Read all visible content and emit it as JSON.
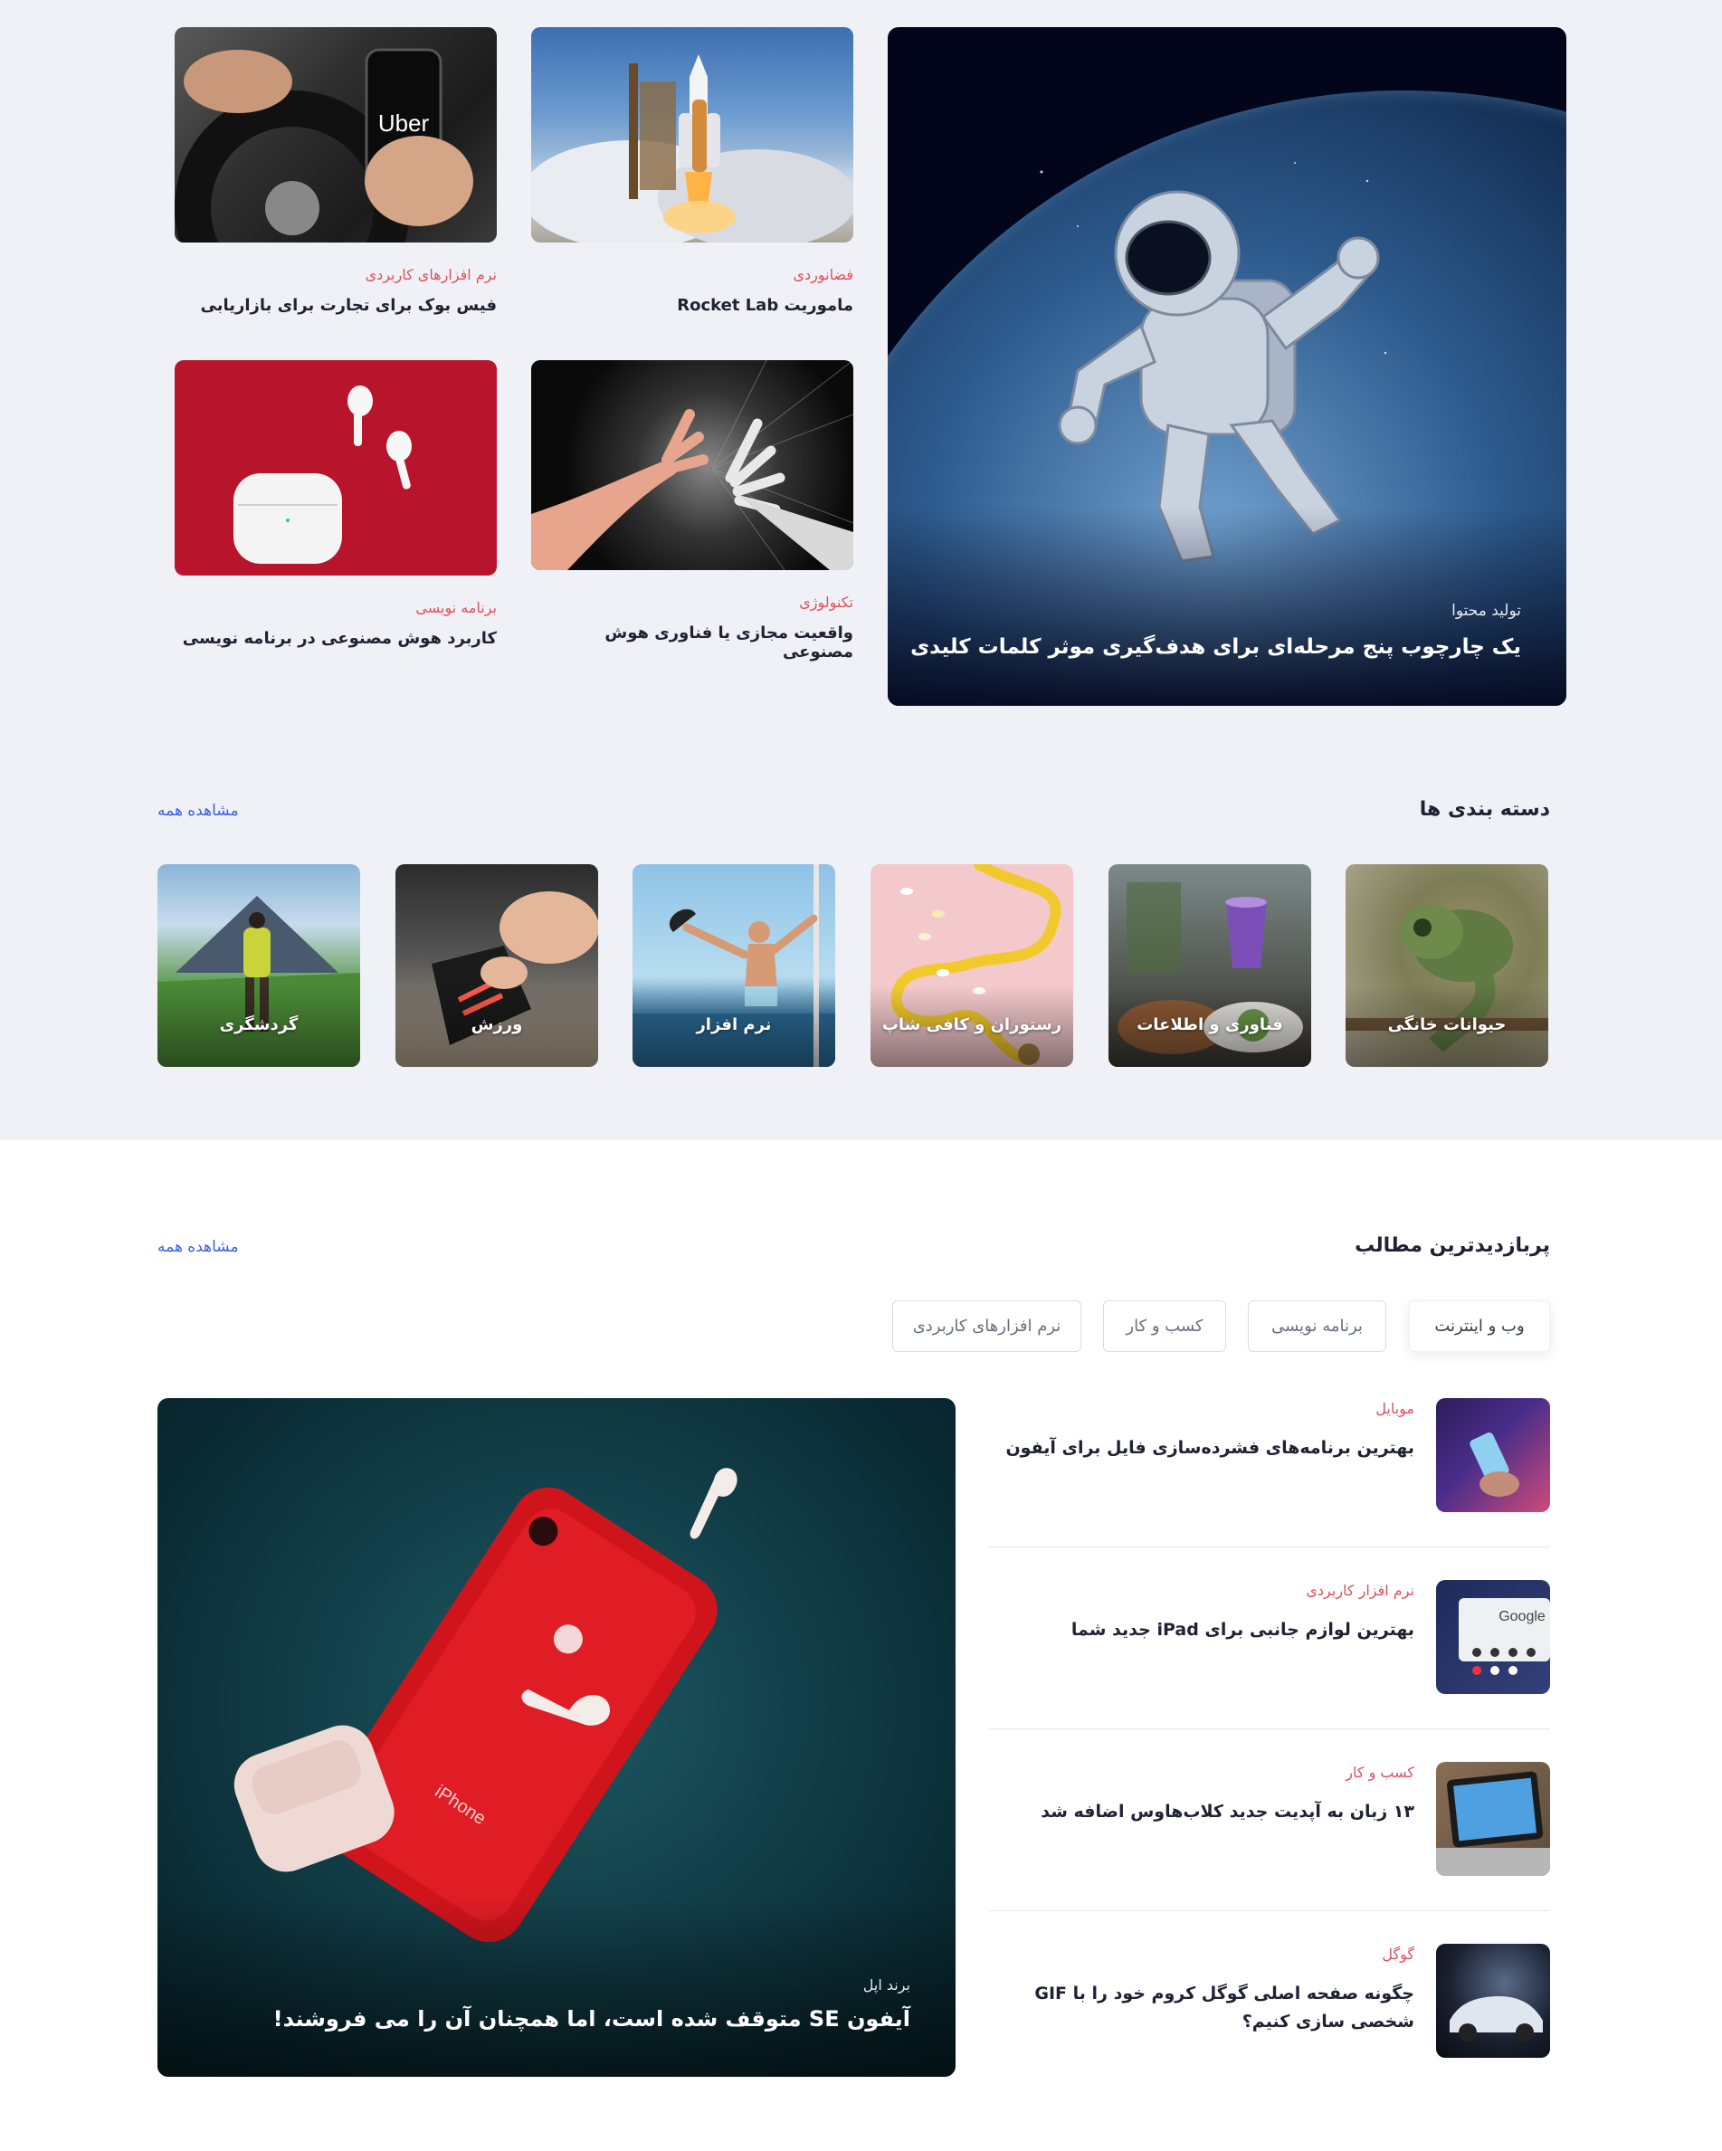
{
  "hero": {
    "category": "تولید محتوا",
    "title": "یک چارچوب پنج مرحله‌ای برای هدف‌گیری موثر کلمات کلیدی"
  },
  "cards": [
    {
      "category": "فضانوردی",
      "title": "ماموریت Rocket Lab"
    },
    {
      "category": "نرم افزارهای کاربردی",
      "title": "فیس بوک برای تجارت برای بازاریابی",
      "image_text": "Uber"
    },
    {
      "category": "تکنولوژی",
      "title": "واقعیت مجازی یا فناوری هوش مصنوعی"
    },
    {
      "category": "برنامه نویسی",
      "title": "کاربرد هوش مصنوعی در برنامه نویسی"
    }
  ],
  "categories_section": {
    "title": "دسته بندی ها",
    "see_all": "مشاهده همه",
    "items": [
      "حیوانات خانگی",
      "فناوری و اطلاعات",
      "رستوران و کافی شاپ",
      "نرم افزار",
      "ورزش",
      "گردشگری"
    ]
  },
  "popular": {
    "title": "پربازدیدترین مطالب",
    "see_all": "مشاهده همه",
    "tabs": [
      "وب و اینترنت",
      "برنامه نویسی",
      "کسب و کار",
      "نرم افزارهای کاربردی"
    ],
    "active_tab": "وب و اینترنت",
    "feature": {
      "category": "برند اپل",
      "title": "آیفون SE متوقف شده است، اما همچنان آن را می فروشند!",
      "image_text": "iPhone"
    },
    "items": [
      {
        "category": "موبایل",
        "title": "بهترین برنامه‌های فشرده‌سازی فایل برای آیفون"
      },
      {
        "category": "نرم افزار کاربردی",
        "title": "بهترین لوازم جانبی برای iPad جدید شما",
        "image_text": "Google"
      },
      {
        "category": "کسب و کار",
        "title": "۱۳ زبان به آپدیت جدید کلاب‌هاوس اضافه شد"
      },
      {
        "category": "گوگل",
        "title": "چگونه صفحه اصلی گوگل کروم خود را با GIF شخصی سازی کنیم؟"
      }
    ]
  },
  "colors": {
    "accent_red": "#e0505a",
    "link_blue": "#3b5fe0",
    "band_gray": "#f0f1f6"
  }
}
